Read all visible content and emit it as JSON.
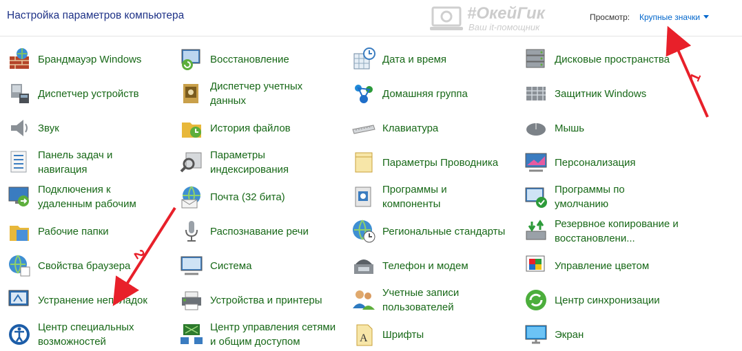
{
  "header": {
    "title": "Настройка параметров компьютера",
    "view_label": "Просмотр:",
    "view_value": "Крупные значки"
  },
  "watermark": {
    "title": "#ОкейГик",
    "subtitle": "Ваш it-помощник"
  },
  "items": [
    [
      {
        "label": "Брандмауэр Windows",
        "icon": "firewall-icon"
      },
      {
        "label": "Диспетчер устройств",
        "icon": "device-manager-icon"
      },
      {
        "label": "Звук",
        "icon": "speaker-icon"
      },
      {
        "label": "Панель задач и\nнавигация",
        "icon": "taskbar-icon"
      },
      {
        "label": "Подключения к\nудаленным рабочим",
        "icon": "remote-desktop-icon"
      },
      {
        "label": "Рабочие папки",
        "icon": "work-folders-icon"
      },
      {
        "label": "Свойства браузера",
        "icon": "internet-options-icon"
      },
      {
        "label": "Устранение неполадок",
        "icon": "troubleshooting-icon"
      },
      {
        "label": "Центр специальных\nвозможностей",
        "icon": "ease-of-access-icon"
      }
    ],
    [
      {
        "label": "Восстановление",
        "icon": "recovery-icon"
      },
      {
        "label": "Диспетчер учетных\nданных",
        "icon": "credential-manager-icon"
      },
      {
        "label": "История файлов",
        "icon": "file-history-icon"
      },
      {
        "label": "Параметры\nиндексирования",
        "icon": "indexing-icon"
      },
      {
        "label": "Почта (32 бита)",
        "icon": "mail-icon"
      },
      {
        "label": "Распознавание речи",
        "icon": "microphone-icon"
      },
      {
        "label": "Система",
        "icon": "system-icon"
      },
      {
        "label": "Устройства и принтеры",
        "icon": "printer-icon"
      },
      {
        "label": "Центр управления сетями\nи общим доступом",
        "icon": "network-center-icon"
      }
    ],
    [
      {
        "label": "Дата и время",
        "icon": "date-time-icon"
      },
      {
        "label": "Домашняя группа",
        "icon": "homegroup-icon"
      },
      {
        "label": "Клавиатура",
        "icon": "keyboard-icon"
      },
      {
        "label": "Параметры Проводника",
        "icon": "explorer-options-icon"
      },
      {
        "label": "Программы и\nкомпоненты",
        "icon": "programs-icon"
      },
      {
        "label": "Региональные стандарты",
        "icon": "region-icon"
      },
      {
        "label": "Телефон и модем",
        "icon": "phone-modem-icon"
      },
      {
        "label": "Учетные записи\nпользователей",
        "icon": "user-accounts-icon"
      },
      {
        "label": "Шрифты",
        "icon": "fonts-icon"
      }
    ],
    [
      {
        "label": "Дисковые пространства",
        "icon": "storage-spaces-icon"
      },
      {
        "label": "Защитник Windows",
        "icon": "defender-icon"
      },
      {
        "label": "Мышь",
        "icon": "mouse-icon"
      },
      {
        "label": "Персонализация",
        "icon": "personalization-icon"
      },
      {
        "label": "Программы по\nумолчанию",
        "icon": "default-programs-icon"
      },
      {
        "label": "Резервное копирование и\nвосстановлени...",
        "icon": "backup-icon"
      },
      {
        "label": "Управление цветом",
        "icon": "color-management-icon"
      },
      {
        "label": "Центр синхронизации",
        "icon": "sync-center-icon"
      },
      {
        "label": "Экран",
        "icon": "display-icon"
      }
    ]
  ],
  "annotations": {
    "arrow1_label": "1",
    "arrow2_label": "2",
    "arrow_color": "#e8202a"
  }
}
